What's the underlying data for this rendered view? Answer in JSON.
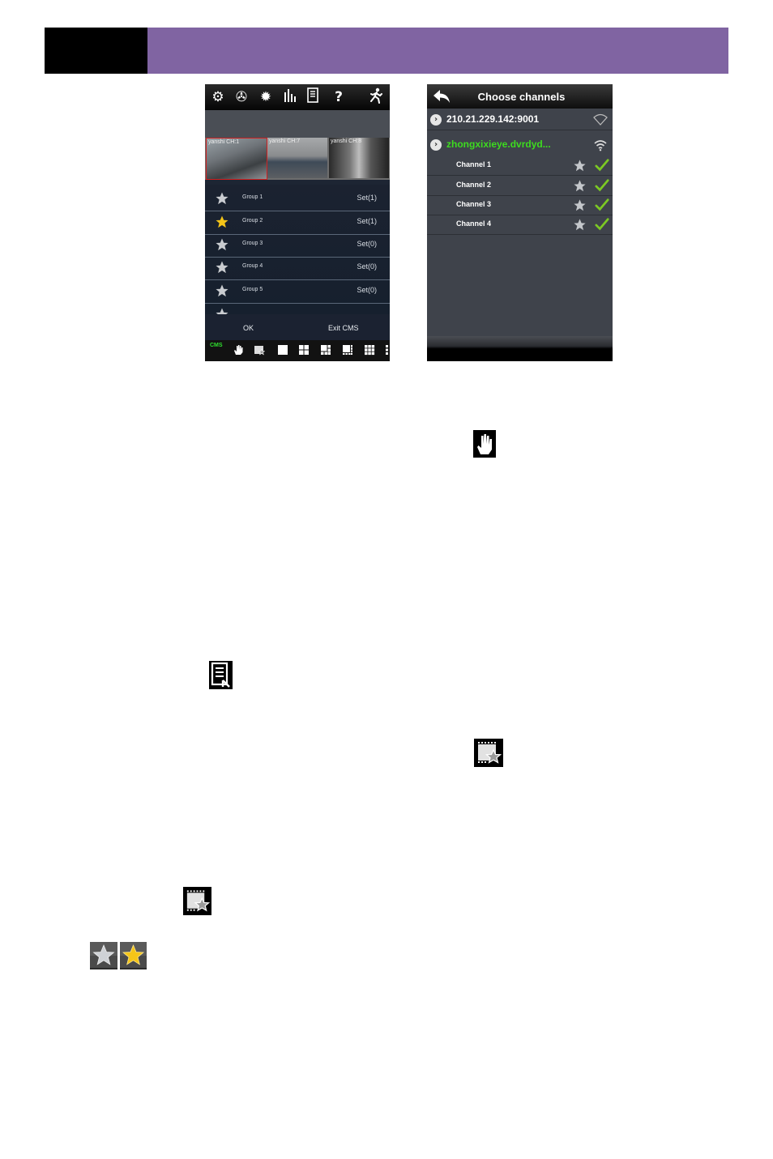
{
  "left_screen": {
    "video_tiles": [
      {
        "label": "yanshi CH:1"
      },
      {
        "label": "yanshi CH:7"
      },
      {
        "label": "yanshi CH:8"
      }
    ],
    "groups": [
      {
        "name": "Group 1",
        "set": "Set(1)",
        "starred": false
      },
      {
        "name": "Group 2",
        "set": "Set(1)",
        "starred": true
      },
      {
        "name": "Group 3",
        "set": "Set(0)",
        "starred": false
      },
      {
        "name": "Group 4",
        "set": "Set(0)",
        "starred": false
      },
      {
        "name": "Group 5",
        "set": "Set(0)",
        "starred": false
      }
    ],
    "ok_label": "OK",
    "exit_label": "Exit CMS",
    "cms_label": "CMS"
  },
  "right_screen": {
    "title": "Choose channels",
    "devices": [
      {
        "name": "210.21.229.142:9001",
        "color": "#ffffff"
      },
      {
        "name": "zhongxixieye.dvrdyd...",
        "color": "#3ddc1f"
      }
    ],
    "channels": [
      "Channel 1",
      "Channel 2",
      "Channel 3",
      "Channel 4"
    ]
  },
  "colors": {
    "header_purple": "#8064a2",
    "header_black": "#000000",
    "star_gold": "#f5c518",
    "check_green": "#7cc924"
  },
  "icons": [
    "hand-icon",
    "list-icon",
    "favorite-icon",
    "star-gray-icon",
    "star-gold-icon"
  ]
}
